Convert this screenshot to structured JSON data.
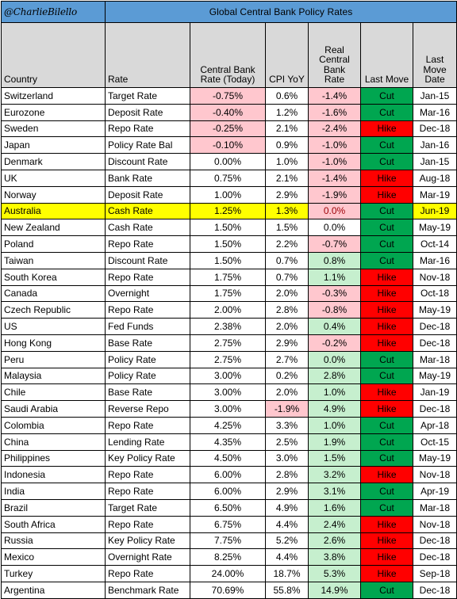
{
  "header": {
    "handle": "@CharlieBilello",
    "title": "Global Central Bank Policy Rates",
    "band_color": "#5B9BD5"
  },
  "columns": [
    {
      "key": "country",
      "label": "Country",
      "align": "left"
    },
    {
      "key": "rate",
      "label": "Rate",
      "align": "left"
    },
    {
      "key": "cbr",
      "label": "Central Bank\nRate (Today)",
      "align": "center"
    },
    {
      "key": "cpi",
      "label": "CPI YoY",
      "align": "center"
    },
    {
      "key": "real",
      "label": "Real\nCentral\nBank\nRate",
      "align": "center"
    },
    {
      "key": "move",
      "label": "Last Move",
      "align": "center"
    },
    {
      "key": "date",
      "label": "Last\nMove\nDate",
      "align": "center"
    }
  ],
  "column_labels": {
    "country": "Country",
    "rate": "Rate",
    "cbr_line1": "Central Bank",
    "cbr_line2": "Rate (Today)",
    "cpi": "CPI YoY",
    "real_line1": "Real",
    "real_line2": "Central",
    "real_line3": "Bank",
    "real_line4": "Rate",
    "move": "Last Move",
    "date_line1": "Last",
    "date_line2": "Move",
    "date_line3": "Date"
  },
  "palette": {
    "title_blue": "#5B9BD5",
    "header_gray": "#D9D9D9",
    "negative_fill": "#FFC7CE",
    "negative_text": "#9C0006",
    "positive_fill": "#C6EFCE",
    "positive_text": "#1C6B30",
    "cut_green": "#00A650",
    "hike_red": "#FF0000",
    "highlight_yellow": "#FFFF00"
  },
  "rows": [
    {
      "country": "Switzerland",
      "rate": "Target Rate",
      "cbr": "-0.75%",
      "cbr_fill": "pink",
      "cpi": "0.6%",
      "cpi_fill": "none",
      "real": "-1.4%",
      "real_fill": "pink",
      "move": "Cut",
      "move_fill": "cut",
      "date": "Jan-15",
      "highlight": false
    },
    {
      "country": "Eurozone",
      "rate": "Deposit Rate",
      "cbr": "-0.40%",
      "cbr_fill": "pink",
      "cpi": "1.2%",
      "cpi_fill": "none",
      "real": "-1.6%",
      "real_fill": "pink",
      "move": "Cut",
      "move_fill": "cut",
      "date": "Mar-16",
      "highlight": false
    },
    {
      "country": "Sweden",
      "rate": "Repo Rate",
      "cbr": "-0.25%",
      "cbr_fill": "pink",
      "cpi": "2.1%",
      "cpi_fill": "none",
      "real": "-2.4%",
      "real_fill": "pink",
      "move": "Hike",
      "move_fill": "hike",
      "date": "Dec-18",
      "highlight": false
    },
    {
      "country": "Japan",
      "rate": "Policy Rate Bal",
      "cbr": "-0.10%",
      "cbr_fill": "pink",
      "cpi": "0.9%",
      "cpi_fill": "none",
      "real": "-1.0%",
      "real_fill": "pink",
      "move": "Cut",
      "move_fill": "cut",
      "date": "Jan-16",
      "highlight": false
    },
    {
      "country": "Denmark",
      "rate": "Discount Rate",
      "cbr": "0.00%",
      "cbr_fill": "none",
      "cpi": "1.0%",
      "cpi_fill": "none",
      "real": "-1.0%",
      "real_fill": "pink",
      "move": "Cut",
      "move_fill": "cut",
      "date": "Jan-15",
      "highlight": false
    },
    {
      "country": "UK",
      "rate": "Bank Rate",
      "cbr": "0.75%",
      "cbr_fill": "none",
      "cpi": "2.1%",
      "cpi_fill": "none",
      "real": "-1.4%",
      "real_fill": "pink",
      "move": "Hike",
      "move_fill": "hike",
      "date": "Aug-18",
      "highlight": false
    },
    {
      "country": "Norway",
      "rate": "Deposit Rate",
      "cbr": "1.00%",
      "cbr_fill": "none",
      "cpi": "2.9%",
      "cpi_fill": "none",
      "real": "-1.9%",
      "real_fill": "pink",
      "move": "Hike",
      "move_fill": "hike",
      "date": "Mar-19",
      "highlight": false
    },
    {
      "country": "Australia",
      "rate": "Cash Rate",
      "cbr": "1.25%",
      "cbr_fill": "none",
      "cpi": "1.3%",
      "cpi_fill": "none",
      "real": "0.0%",
      "real_fill": "pink",
      "move": "Cut",
      "move_fill": "cut",
      "date": "Jun-19",
      "highlight": true
    },
    {
      "country": "New Zealand",
      "rate": "Cash Rate",
      "cbr": "1.50%",
      "cbr_fill": "none",
      "cpi": "1.5%",
      "cpi_fill": "none",
      "real": "0.0%",
      "real_fill": "none",
      "move": "Cut",
      "move_fill": "cut",
      "date": "May-19",
      "highlight": false
    },
    {
      "country": "Poland",
      "rate": "Repo Rate",
      "cbr": "1.50%",
      "cbr_fill": "none",
      "cpi": "2.2%",
      "cpi_fill": "none",
      "real": "-0.7%",
      "real_fill": "pink",
      "move": "Cut",
      "move_fill": "cut",
      "date": "Oct-14",
      "highlight": false
    },
    {
      "country": "Taiwan",
      "rate": "Discount Rate",
      "cbr": "1.50%",
      "cbr_fill": "none",
      "cpi": "0.7%",
      "cpi_fill": "none",
      "real": "0.8%",
      "real_fill": "green",
      "move": "Cut",
      "move_fill": "cut",
      "date": "Mar-16",
      "highlight": false
    },
    {
      "country": "South Korea",
      "rate": "Repo Rate",
      "cbr": "1.75%",
      "cbr_fill": "none",
      "cpi": "0.7%",
      "cpi_fill": "none",
      "real": "1.1%",
      "real_fill": "green",
      "move": "Hike",
      "move_fill": "hike",
      "date": "Nov-18",
      "highlight": false
    },
    {
      "country": "Canada",
      "rate": "Overnight",
      "cbr": "1.75%",
      "cbr_fill": "none",
      "cpi": "2.0%",
      "cpi_fill": "none",
      "real": "-0.3%",
      "real_fill": "pink",
      "move": "Hike",
      "move_fill": "hike",
      "date": "Oct-18",
      "highlight": false
    },
    {
      "country": "Czech Republic",
      "rate": "Repo Rate",
      "cbr": "2.00%",
      "cbr_fill": "none",
      "cpi": "2.8%",
      "cpi_fill": "none",
      "real": "-0.8%",
      "real_fill": "pink",
      "move": "Hike",
      "move_fill": "hike",
      "date": "May-19",
      "highlight": false
    },
    {
      "country": "US",
      "rate": "Fed Funds",
      "cbr": "2.38%",
      "cbr_fill": "none",
      "cpi": "2.0%",
      "cpi_fill": "none",
      "real": "0.4%",
      "real_fill": "green",
      "move": "Hike",
      "move_fill": "hike",
      "date": "Dec-18",
      "highlight": false
    },
    {
      "country": "Hong Kong",
      "rate": "Base Rate",
      "cbr": "2.75%",
      "cbr_fill": "none",
      "cpi": "2.9%",
      "cpi_fill": "none",
      "real": "-0.2%",
      "real_fill": "pink",
      "move": "Hike",
      "move_fill": "hike",
      "date": "Dec-18",
      "highlight": false
    },
    {
      "country": "Peru",
      "rate": "Policy Rate",
      "cbr": "2.75%",
      "cbr_fill": "none",
      "cpi": "2.7%",
      "cpi_fill": "none",
      "real": "0.0%",
      "real_fill": "green",
      "move": "Cut",
      "move_fill": "cut",
      "date": "Mar-18",
      "highlight": false
    },
    {
      "country": "Malaysia",
      "rate": "Policy Rate",
      "cbr": "3.00%",
      "cbr_fill": "none",
      "cpi": "0.2%",
      "cpi_fill": "none",
      "real": "2.8%",
      "real_fill": "green",
      "move": "Cut",
      "move_fill": "cut",
      "date": "May-19",
      "highlight": false
    },
    {
      "country": "Chile",
      "rate": "Base Rate",
      "cbr": "3.00%",
      "cbr_fill": "none",
      "cpi": "2.0%",
      "cpi_fill": "none",
      "real": "1.0%",
      "real_fill": "green",
      "move": "Hike",
      "move_fill": "hike",
      "date": "Jan-19",
      "highlight": false
    },
    {
      "country": "Saudi Arabia",
      "rate": "Reverse Repo",
      "cbr": "3.00%",
      "cbr_fill": "none",
      "cpi": "-1.9%",
      "cpi_fill": "pink",
      "real": "4.9%",
      "real_fill": "green",
      "move": "Hike",
      "move_fill": "hike",
      "date": "Dec-18",
      "highlight": false
    },
    {
      "country": "Colombia",
      "rate": "Repo Rate",
      "cbr": "4.25%",
      "cbr_fill": "none",
      "cpi": "3.3%",
      "cpi_fill": "none",
      "real": "1.0%",
      "real_fill": "green",
      "move": "Cut",
      "move_fill": "cut",
      "date": "Apr-18",
      "highlight": false
    },
    {
      "country": "China",
      "rate": "Lending Rate",
      "cbr": "4.35%",
      "cbr_fill": "none",
      "cpi": "2.5%",
      "cpi_fill": "none",
      "real": "1.9%",
      "real_fill": "green",
      "move": "Cut",
      "move_fill": "cut",
      "date": "Oct-15",
      "highlight": false
    },
    {
      "country": "Philippines",
      "rate": "Key Policy Rate",
      "cbr": "4.50%",
      "cbr_fill": "none",
      "cpi": "3.0%",
      "cpi_fill": "none",
      "real": "1.5%",
      "real_fill": "green",
      "move": "Cut",
      "move_fill": "cut",
      "date": "May-19",
      "highlight": false
    },
    {
      "country": "Indonesia",
      "rate": "Repo Rate",
      "cbr": "6.00%",
      "cbr_fill": "none",
      "cpi": "2.8%",
      "cpi_fill": "none",
      "real": "3.2%",
      "real_fill": "green",
      "move": "Hike",
      "move_fill": "hike",
      "date": "Nov-18",
      "highlight": false
    },
    {
      "country": "India",
      "rate": "Repo Rate",
      "cbr": "6.00%",
      "cbr_fill": "none",
      "cpi": "2.9%",
      "cpi_fill": "none",
      "real": "3.1%",
      "real_fill": "green",
      "move": "Cut",
      "move_fill": "cut",
      "date": "Apr-19",
      "highlight": false
    },
    {
      "country": "Brazil",
      "rate": "Target Rate",
      "cbr": "6.50%",
      "cbr_fill": "none",
      "cpi": "4.9%",
      "cpi_fill": "none",
      "real": "1.6%",
      "real_fill": "green",
      "move": "Cut",
      "move_fill": "cut",
      "date": "Mar-18",
      "highlight": false
    },
    {
      "country": "South Africa",
      "rate": "Repo Rate",
      "cbr": "6.75%",
      "cbr_fill": "none",
      "cpi": "4.4%",
      "cpi_fill": "none",
      "real": "2.4%",
      "real_fill": "green",
      "move": "Hike",
      "move_fill": "hike",
      "date": "Nov-18",
      "highlight": false
    },
    {
      "country": "Russia",
      "rate": "Key Policy Rate",
      "cbr": "7.75%",
      "cbr_fill": "none",
      "cpi": "5.2%",
      "cpi_fill": "none",
      "real": "2.6%",
      "real_fill": "green",
      "move": "Hike",
      "move_fill": "hike",
      "date": "Dec-18",
      "highlight": false
    },
    {
      "country": "Mexico",
      "rate": "Overnight Rate",
      "cbr": "8.25%",
      "cbr_fill": "none",
      "cpi": "4.4%",
      "cpi_fill": "none",
      "real": "3.8%",
      "real_fill": "green",
      "move": "Hike",
      "move_fill": "hike",
      "date": "Dec-18",
      "highlight": false
    },
    {
      "country": "Turkey",
      "rate": "Repo Rate",
      "cbr": "24.00%",
      "cbr_fill": "none",
      "cpi": "18.7%",
      "cpi_fill": "none",
      "real": "5.3%",
      "real_fill": "green",
      "move": "Hike",
      "move_fill": "hike",
      "date": "Sep-18",
      "highlight": false
    },
    {
      "country": "Argentina",
      "rate": "Benchmark Rate",
      "cbr": "70.69%",
      "cbr_fill": "none",
      "cpi": "55.8%",
      "cpi_fill": "none",
      "real": "14.9%",
      "real_fill": "green",
      "move": "Cut",
      "move_fill": "cut",
      "date": "Dec-18",
      "highlight": false
    }
  ]
}
